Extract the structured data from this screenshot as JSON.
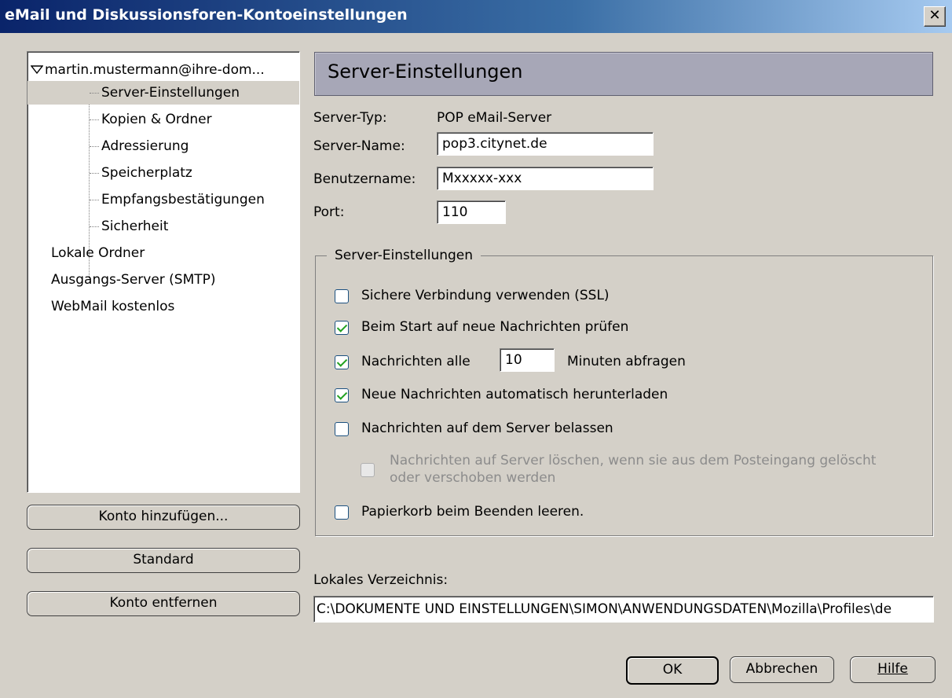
{
  "window": {
    "title": "eMail und Diskussionsforen-Kontoeinstellungen",
    "close_label": "✕"
  },
  "tree": {
    "account": "martin.mustermann@ihre-dom...",
    "sub_items": [
      "Server-Einstellungen",
      "Kopien & Ordner",
      "Adressierung",
      "Speicherplatz",
      "Empfangsbestätigungen",
      "Sicherheit"
    ],
    "other_items": [
      "Lokale Ordner",
      "Ausgangs-Server (SMTP)",
      "WebMail kostenlos"
    ]
  },
  "left_buttons": {
    "add": "Konto hinzufügen...",
    "default": "Standard",
    "remove": "Konto entfernen"
  },
  "header": {
    "title": "Server-Einstellungen"
  },
  "server": {
    "type_label": "Server-Typ:",
    "type_value": "POP eMail-Server",
    "name_label": "Server-Name:",
    "name_value": "pop3.citynet.de",
    "user_label": "Benutzername:",
    "user_value": "Mxxxxx-xxx",
    "port_label": "Port:",
    "port_value": "110"
  },
  "group": {
    "title": "Server-Einstellungen",
    "ssl": {
      "label": "Sichere Verbindung verwenden (SSL)",
      "checked": false
    },
    "check_start": {
      "label": "Beim Start auf neue Nachrichten prüfen",
      "checked": true
    },
    "check_every": {
      "label_pre": "Nachrichten alle",
      "minutes": "10",
      "label_post": "Minuten abfragen",
      "checked": true
    },
    "auto_download": {
      "label": "Neue Nachrichten automatisch herunterladen",
      "checked": true
    },
    "leave_on_server": {
      "label": "Nachrichten auf dem Server belassen",
      "checked": false
    },
    "delete_from_server": {
      "line1": "Nachrichten auf Server löschen, wenn sie aus dem Posteingang gelöscht",
      "line2": "oder verschoben werden",
      "checked": false,
      "disabled": true
    },
    "empty_trash": {
      "label": "Papierkorb beim Beenden leeren.",
      "checked": false
    }
  },
  "local_dir": {
    "label": "Lokales Verzeichnis:",
    "value": "C:\\DOKUMENTE UND EINSTELLUNGEN\\SIMON\\ANWENDUNGSDATEN\\Mozilla\\Profiles\\de"
  },
  "footer": {
    "ok": "OK",
    "cancel": "Abbrechen",
    "help": "Hilfe"
  }
}
